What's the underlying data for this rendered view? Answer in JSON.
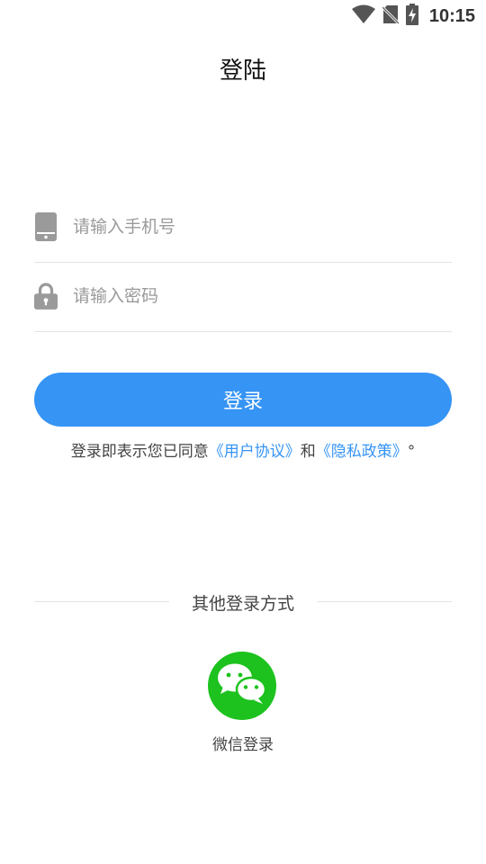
{
  "status_bar": {
    "time": "10:15"
  },
  "header": {
    "title": "登陆"
  },
  "form": {
    "phone_placeholder": "请输入手机号",
    "password_placeholder": "请输入密码",
    "login_label": "登录"
  },
  "agreement": {
    "prefix": "登录即表示您已同意",
    "user_agreement": "《用户协议》",
    "conjunction": "和",
    "privacy_policy": "《隐私政策》",
    "suffix": "°"
  },
  "other_login": {
    "divider_label": "其他登录方式",
    "wechat_label": "微信登录"
  },
  "colors": {
    "accent": "#3694f5",
    "wechat": "#1dc21e"
  },
  "icons": [
    "wifi-icon",
    "no-sim-icon",
    "battery-charging-icon",
    "phone-icon",
    "lock-icon",
    "wechat-icon"
  ]
}
